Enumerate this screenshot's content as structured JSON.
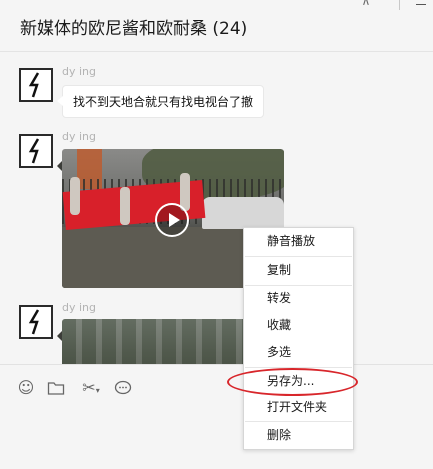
{
  "window": {
    "title": "新媒体的欧尼酱和欧耐桑 (24)",
    "pin_icon": "pin-icon"
  },
  "messages": [
    {
      "sender": "dy   ing",
      "type": "text",
      "text": "找不到天地合就只有找电视台了撤"
    },
    {
      "sender": "dy   ing",
      "type": "video"
    },
    {
      "sender": "dy   ing",
      "type": "video"
    }
  ],
  "toolbar": {
    "icons": [
      "emoji-icon",
      "folder-icon",
      "scissors-icon",
      "chat-history-icon"
    ]
  },
  "context_menu": {
    "items": [
      "静音播放",
      "复制",
      "转发",
      "收藏",
      "多选",
      "另存为...",
      "打开文件夹",
      "删除"
    ],
    "highlighted": "另存为...",
    "highlight_color": "#d8262b"
  }
}
